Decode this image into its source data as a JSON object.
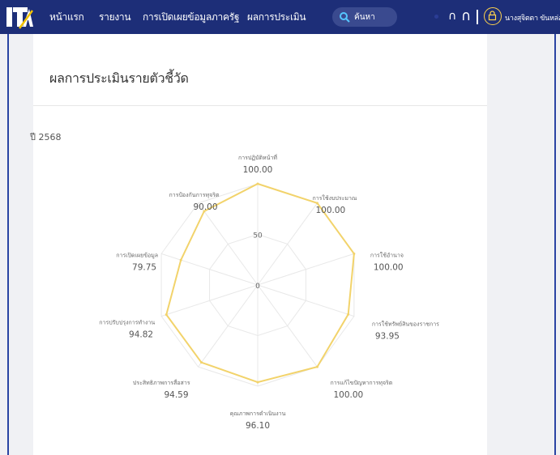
{
  "nav": {
    "items": [
      "หน้าแรก",
      "รายงาน",
      "การเปิดเผยข้อมูลภาครัฐ",
      "ผลการประเมิน"
    ],
    "search_placeholder": "ค้นหา",
    "user_name": "นางสุจิตตา ขันหล่อ"
  },
  "page": {
    "title": "ผลการประเมินรายตัวชี้วัด",
    "year_label": "ปี 2568"
  },
  "colors": {
    "navbar": "#1d2e78",
    "series": "#f2d36b",
    "accent": "#ffd34d"
  },
  "chart_data": {
    "type": "radar",
    "rlim": [
      0,
      100
    ],
    "ticks": [
      0,
      50,
      100
    ],
    "series": [
      {
        "values": [
          100.0,
          100.0,
          100.0,
          93.95,
          100.0,
          96.1,
          94.59,
          94.82,
          79.75,
          90.0
        ]
      }
    ],
    "categories": [
      "การปฏิบัติหน้าที่",
      "การใช้งบประมาณ",
      "การใช้อำนาจ",
      "การใช้ทรัพย์สินของราชการ",
      "การแก้ไขปัญหาการทุจริต",
      "คุณภาพการดำเนินงาน",
      "ประสิทธิภาพการสื่อสาร",
      "การปรับปรุงการทำงาน",
      "การเปิดเผยข้อมูล",
      "การป้องกันการทุจริต"
    ],
    "value_labels": [
      "100.00",
      "100.00",
      "100.00",
      "93.95",
      "100.00",
      "96.10",
      "94.59",
      "94.82",
      "79.75",
      "90.00"
    ]
  }
}
